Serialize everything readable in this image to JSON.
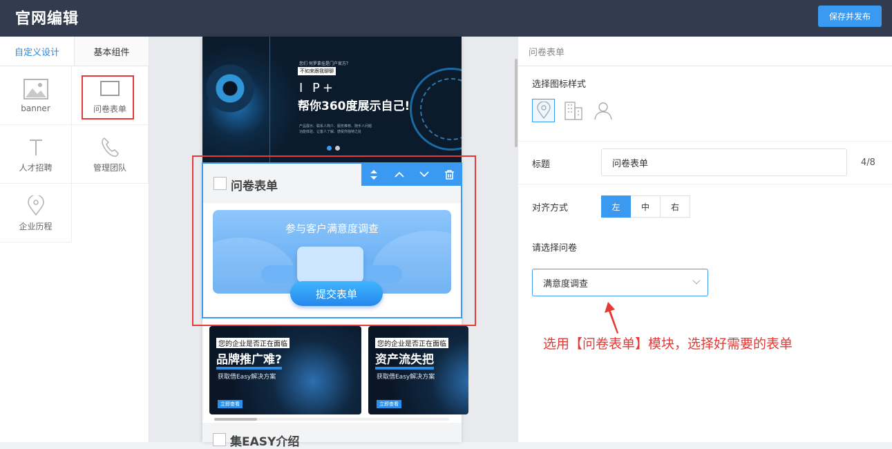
{
  "app": {
    "title": "官网编辑",
    "publish_label": "保存并发布"
  },
  "left_panel": {
    "tabs": [
      {
        "label": "自定义设计",
        "active": true
      },
      {
        "label": "基本组件",
        "active": false
      }
    ],
    "components": [
      {
        "label": "banner",
        "icon": "image-icon"
      },
      {
        "label": "问卷表单",
        "icon": "rectangle-icon",
        "selected": true
      },
      {
        "label": "人才招聘",
        "icon": "letter-t-icon"
      },
      {
        "label": "管理团队",
        "icon": "phone-icon"
      },
      {
        "label": "企业历程",
        "icon": "map-pin-icon"
      }
    ]
  },
  "preview": {
    "banner": {
      "small_text": "您们 何罗拿挂是门户官方？",
      "tag": "不如来跟我聊聊",
      "ip_text": "I P+",
      "headline": "帮你360度展示自己!",
      "desc_line1": "产品展示、联系人简介、服务推荐、随手人问题",
      "desc_line2": "功能体验、让客人了解、感受你独特之处",
      "slides": 2,
      "active_slide": 1
    },
    "survey": {
      "title": "问卷表单",
      "card_title": "参与客户满意度调查",
      "submit_label": "提交表单",
      "tools": [
        "drag-handle-icon",
        "move-up-icon",
        "move-down-icon",
        "delete-icon"
      ]
    },
    "cards": [
      {
        "line1": "您的企业是否正在面临",
        "line2": "品牌推广难?",
        "line3": "获取借Easy解决方案",
        "button": "立即查看"
      },
      {
        "line1": "您的企业是否正在面临",
        "line2": "资产流失把",
        "line3": "获取借Easy解决方案",
        "button": "立即查看"
      }
    ],
    "next_section": "集EASY介绍"
  },
  "right_panel": {
    "header": "问卷表单",
    "icon_style_label": "选择图标样式",
    "icon_styles": [
      "map-pin-icon",
      "building-icon",
      "person-icon"
    ],
    "selected_icon_style": "map-pin-icon",
    "title_label": "标题",
    "title_value": "问卷表单",
    "title_count": "4/8",
    "align_label": "对齐方式",
    "align_options": [
      "左",
      "中",
      "右"
    ],
    "align_selected": "左",
    "survey_label": "请选择问卷",
    "survey_value": "满意度调查"
  },
  "annotation": {
    "note": "选用【问卷表单】模块，选择好需要的表单",
    "color": "#e53935"
  },
  "colors": {
    "accent": "#3a9af1",
    "topbar": "#323c4e",
    "highlight": "#e53935"
  }
}
